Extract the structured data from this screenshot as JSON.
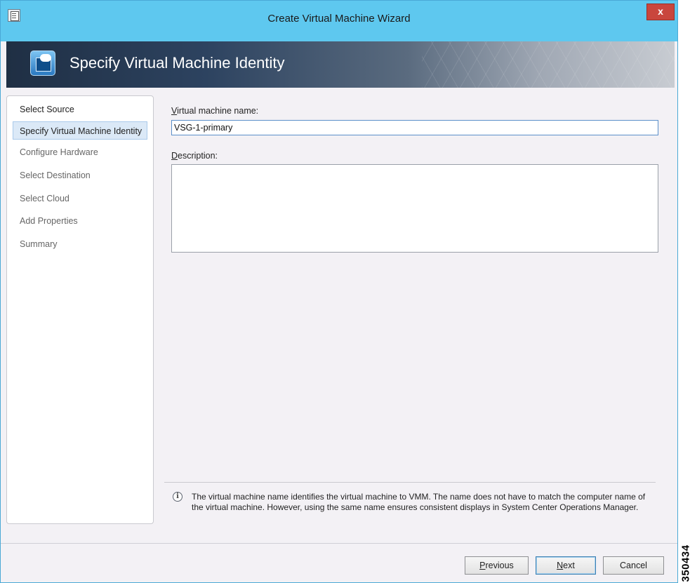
{
  "window": {
    "title": "Create Virtual Machine Wizard",
    "close_label": "x"
  },
  "banner": {
    "title": "Specify Virtual Machine Identity",
    "icon": "vm-cloud-icon"
  },
  "nav": {
    "items": [
      {
        "label": "Select Source",
        "state": "completed"
      },
      {
        "label": "Specify Virtual Machine Identity",
        "state": "active"
      },
      {
        "label": "Configure Hardware",
        "state": "pending"
      },
      {
        "label": "Select Destination",
        "state": "pending"
      },
      {
        "label": "Select Cloud",
        "state": "pending"
      },
      {
        "label": "Add Properties",
        "state": "pending"
      },
      {
        "label": "Summary",
        "state": "pending"
      }
    ]
  },
  "form": {
    "name_label_accel": "V",
    "name_label_rest": "irtual machine name:",
    "name_value": "VSG-1-primary",
    "desc_label_accel": "D",
    "desc_label_rest": "escription:",
    "desc_value": ""
  },
  "info": {
    "icon": "info-icon",
    "text": "The virtual machine name identifies the virtual machine to VMM. The name does not have to match the computer name of the virtual machine. However, using the same name ensures consistent displays in System Center Operations Manager."
  },
  "buttons": {
    "previous_accel": "P",
    "previous_rest": "revious",
    "next_accel": "N",
    "next_rest": "ext",
    "cancel": "Cancel"
  },
  "edge_code": "350434",
  "colors": {
    "titlebar": "#5ec8ef",
    "close": "#c9463d",
    "active_step": "#dbe9f7",
    "window_bg": "#f3f1f5"
  }
}
